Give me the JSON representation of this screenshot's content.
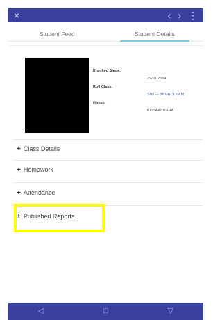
{
  "topbar": {
    "close_icon": "×",
    "back_icon": "‹",
    "forward_icon": "›",
    "more_icon": "⋮"
  },
  "tabs": [
    {
      "label": "Student Feed",
      "active": false
    },
    {
      "label": "Student Details",
      "active": true
    }
  ],
  "details": {
    "enrolled_label": "Enrolled Since:",
    "enrolled_value": "29/01/2014",
    "roll_label": "Roll Class:",
    "roll_value": "SIM — 9B1/ROLNAM",
    "house_label": "House:",
    "house_value": "KOBAABURRA"
  },
  "sections": [
    {
      "label": "Class Details"
    },
    {
      "label": "Homework"
    },
    {
      "label": "Attendance"
    },
    {
      "label": "Published Reports"
    }
  ],
  "bottombar": {
    "back_icon": "◁",
    "home_icon": "□",
    "recents_icon": "▽"
  },
  "colors": {
    "brand": "#3b3f9e",
    "tab_indicator": "#7ec9e8",
    "highlight": "#ffff00"
  }
}
